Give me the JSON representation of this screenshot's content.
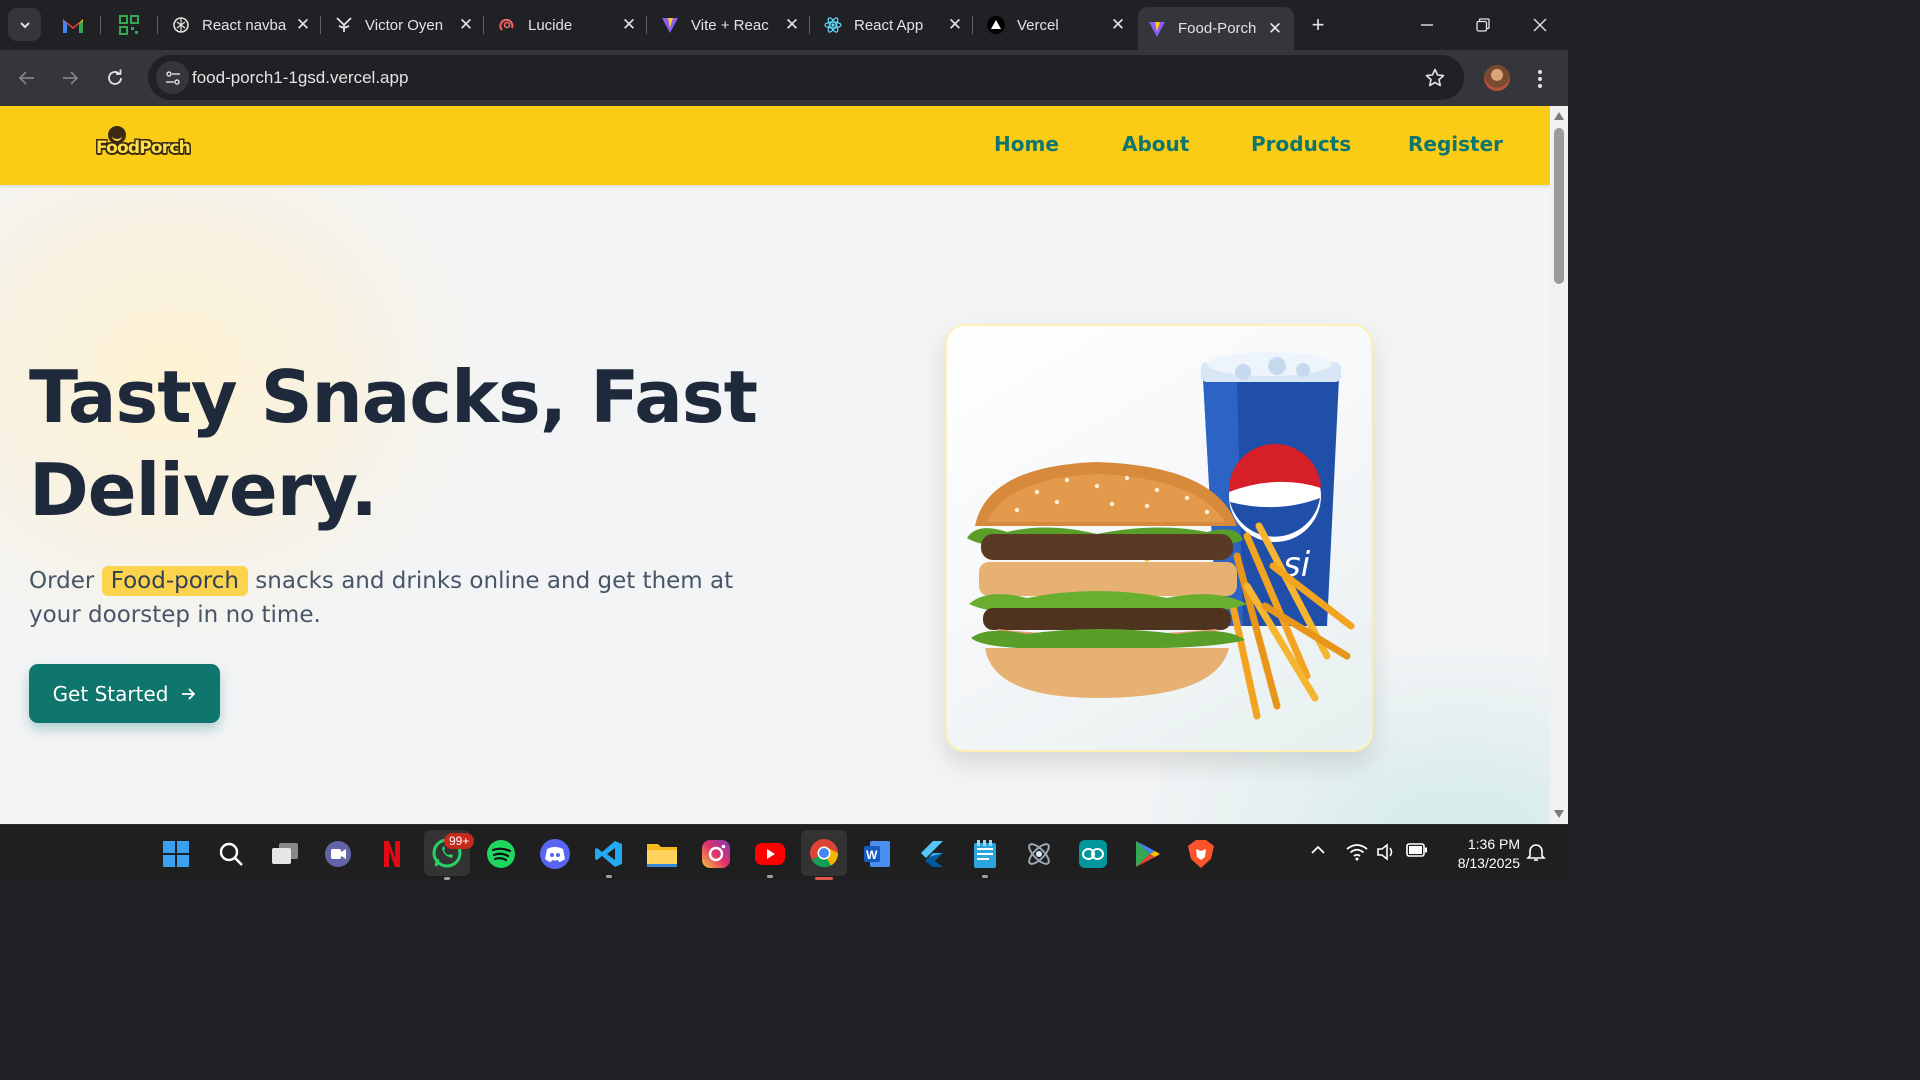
{
  "browser": {
    "tabs": [
      {
        "title": "React navba"
      },
      {
        "title": "Victor Oyen"
      },
      {
        "title": "Lucide"
      },
      {
        "title": "Vite + Reac"
      },
      {
        "title": "React App"
      },
      {
        "title": "Vercel"
      },
      {
        "title": "Food-Porch",
        "active": true
      }
    ],
    "url": "food-porch1-1gsd.vercel.app"
  },
  "site": {
    "logo_text": "FoodPorch",
    "nav": [
      "Home",
      "About",
      "Products",
      "Register"
    ],
    "hero": {
      "title_line1": "Tasty Snacks, Fast",
      "title_line2": "Delivery.",
      "sub_before": "Order",
      "sub_highlight": "Food-porch",
      "sub_after": "snacks and drinks online and get them at your doorstep in no time.",
      "cta_label": "Get Started",
      "cta_icon": "arrow-right-icon"
    },
    "card_image": "burger-fries-pepsi-image",
    "cup_text": "si"
  },
  "taskbar": {
    "apps": [
      "windows-start",
      "search",
      "task-view",
      "teams",
      "netflix",
      "whatsapp",
      "spotify",
      "discord",
      "vscode",
      "file-explorer",
      "instagram",
      "youtube",
      "chrome",
      "word",
      "flutter",
      "notepad",
      "postman",
      "arduino",
      "play-store",
      "brave"
    ],
    "whatsapp_badge": "99+",
    "time": "1:36 PM",
    "date": "8/13/2025"
  },
  "colors": {
    "navbar_bg": "#facc15",
    "accent_teal": "#0f766e",
    "title_text": "#1e293b",
    "highlight": "#fcd34d"
  }
}
